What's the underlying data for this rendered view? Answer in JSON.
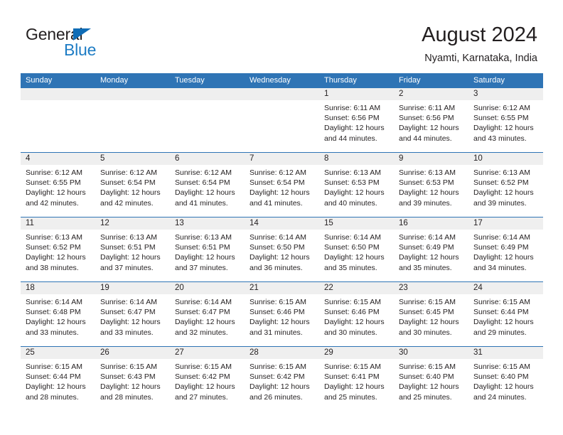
{
  "brand": {
    "name_part1": "General",
    "name_part2": "Blue",
    "triangle_icon": "triangle-icon",
    "colors": {
      "dark": "#231f20",
      "blue": "#1d7cc4",
      "triangle": "#0f6cb6"
    }
  },
  "header": {
    "month_title": "August 2024",
    "location": "Nyamti, Karnataka, India"
  },
  "calendar": {
    "accent_color": "#2f74b5",
    "daynum_strip_color": "#efefef",
    "weekdays": [
      "Sunday",
      "Monday",
      "Tuesday",
      "Wednesday",
      "Thursday",
      "Friday",
      "Saturday"
    ],
    "weeks": [
      [
        {
          "day": "",
          "empty": true
        },
        {
          "day": "",
          "empty": true
        },
        {
          "day": "",
          "empty": true
        },
        {
          "day": "",
          "empty": true
        },
        {
          "day": "1",
          "sunrise": "Sunrise: 6:11 AM",
          "sunset": "Sunset: 6:56 PM",
          "daylight1": "Daylight: 12 hours",
          "daylight2": "and 44 minutes."
        },
        {
          "day": "2",
          "sunrise": "Sunrise: 6:11 AM",
          "sunset": "Sunset: 6:56 PM",
          "daylight1": "Daylight: 12 hours",
          "daylight2": "and 44 minutes."
        },
        {
          "day": "3",
          "sunrise": "Sunrise: 6:12 AM",
          "sunset": "Sunset: 6:55 PM",
          "daylight1": "Daylight: 12 hours",
          "daylight2": "and 43 minutes."
        }
      ],
      [
        {
          "day": "4",
          "sunrise": "Sunrise: 6:12 AM",
          "sunset": "Sunset: 6:55 PM",
          "daylight1": "Daylight: 12 hours",
          "daylight2": "and 42 minutes."
        },
        {
          "day": "5",
          "sunrise": "Sunrise: 6:12 AM",
          "sunset": "Sunset: 6:54 PM",
          "daylight1": "Daylight: 12 hours",
          "daylight2": "and 42 minutes."
        },
        {
          "day": "6",
          "sunrise": "Sunrise: 6:12 AM",
          "sunset": "Sunset: 6:54 PM",
          "daylight1": "Daylight: 12 hours",
          "daylight2": "and 41 minutes."
        },
        {
          "day": "7",
          "sunrise": "Sunrise: 6:12 AM",
          "sunset": "Sunset: 6:54 PM",
          "daylight1": "Daylight: 12 hours",
          "daylight2": "and 41 minutes."
        },
        {
          "day": "8",
          "sunrise": "Sunrise: 6:13 AM",
          "sunset": "Sunset: 6:53 PM",
          "daylight1": "Daylight: 12 hours",
          "daylight2": "and 40 minutes."
        },
        {
          "day": "9",
          "sunrise": "Sunrise: 6:13 AM",
          "sunset": "Sunset: 6:53 PM",
          "daylight1": "Daylight: 12 hours",
          "daylight2": "and 39 minutes."
        },
        {
          "day": "10",
          "sunrise": "Sunrise: 6:13 AM",
          "sunset": "Sunset: 6:52 PM",
          "daylight1": "Daylight: 12 hours",
          "daylight2": "and 39 minutes."
        }
      ],
      [
        {
          "day": "11",
          "sunrise": "Sunrise: 6:13 AM",
          "sunset": "Sunset: 6:52 PM",
          "daylight1": "Daylight: 12 hours",
          "daylight2": "and 38 minutes."
        },
        {
          "day": "12",
          "sunrise": "Sunrise: 6:13 AM",
          "sunset": "Sunset: 6:51 PM",
          "daylight1": "Daylight: 12 hours",
          "daylight2": "and 37 minutes."
        },
        {
          "day": "13",
          "sunrise": "Sunrise: 6:13 AM",
          "sunset": "Sunset: 6:51 PM",
          "daylight1": "Daylight: 12 hours",
          "daylight2": "and 37 minutes."
        },
        {
          "day": "14",
          "sunrise": "Sunrise: 6:14 AM",
          "sunset": "Sunset: 6:50 PM",
          "daylight1": "Daylight: 12 hours",
          "daylight2": "and 36 minutes."
        },
        {
          "day": "15",
          "sunrise": "Sunrise: 6:14 AM",
          "sunset": "Sunset: 6:50 PM",
          "daylight1": "Daylight: 12 hours",
          "daylight2": "and 35 minutes."
        },
        {
          "day": "16",
          "sunrise": "Sunrise: 6:14 AM",
          "sunset": "Sunset: 6:49 PM",
          "daylight1": "Daylight: 12 hours",
          "daylight2": "and 35 minutes."
        },
        {
          "day": "17",
          "sunrise": "Sunrise: 6:14 AM",
          "sunset": "Sunset: 6:49 PM",
          "daylight1": "Daylight: 12 hours",
          "daylight2": "and 34 minutes."
        }
      ],
      [
        {
          "day": "18",
          "sunrise": "Sunrise: 6:14 AM",
          "sunset": "Sunset: 6:48 PM",
          "daylight1": "Daylight: 12 hours",
          "daylight2": "and 33 minutes."
        },
        {
          "day": "19",
          "sunrise": "Sunrise: 6:14 AM",
          "sunset": "Sunset: 6:47 PM",
          "daylight1": "Daylight: 12 hours",
          "daylight2": "and 33 minutes."
        },
        {
          "day": "20",
          "sunrise": "Sunrise: 6:14 AM",
          "sunset": "Sunset: 6:47 PM",
          "daylight1": "Daylight: 12 hours",
          "daylight2": "and 32 minutes."
        },
        {
          "day": "21",
          "sunrise": "Sunrise: 6:15 AM",
          "sunset": "Sunset: 6:46 PM",
          "daylight1": "Daylight: 12 hours",
          "daylight2": "and 31 minutes."
        },
        {
          "day": "22",
          "sunrise": "Sunrise: 6:15 AM",
          "sunset": "Sunset: 6:46 PM",
          "daylight1": "Daylight: 12 hours",
          "daylight2": "and 30 minutes."
        },
        {
          "day": "23",
          "sunrise": "Sunrise: 6:15 AM",
          "sunset": "Sunset: 6:45 PM",
          "daylight1": "Daylight: 12 hours",
          "daylight2": "and 30 minutes."
        },
        {
          "day": "24",
          "sunrise": "Sunrise: 6:15 AM",
          "sunset": "Sunset: 6:44 PM",
          "daylight1": "Daylight: 12 hours",
          "daylight2": "and 29 minutes."
        }
      ],
      [
        {
          "day": "25",
          "sunrise": "Sunrise: 6:15 AM",
          "sunset": "Sunset: 6:44 PM",
          "daylight1": "Daylight: 12 hours",
          "daylight2": "and 28 minutes."
        },
        {
          "day": "26",
          "sunrise": "Sunrise: 6:15 AM",
          "sunset": "Sunset: 6:43 PM",
          "daylight1": "Daylight: 12 hours",
          "daylight2": "and 28 minutes."
        },
        {
          "day": "27",
          "sunrise": "Sunrise: 6:15 AM",
          "sunset": "Sunset: 6:42 PM",
          "daylight1": "Daylight: 12 hours",
          "daylight2": "and 27 minutes."
        },
        {
          "day": "28",
          "sunrise": "Sunrise: 6:15 AM",
          "sunset": "Sunset: 6:42 PM",
          "daylight1": "Daylight: 12 hours",
          "daylight2": "and 26 minutes."
        },
        {
          "day": "29",
          "sunrise": "Sunrise: 6:15 AM",
          "sunset": "Sunset: 6:41 PM",
          "daylight1": "Daylight: 12 hours",
          "daylight2": "and 25 minutes."
        },
        {
          "day": "30",
          "sunrise": "Sunrise: 6:15 AM",
          "sunset": "Sunset: 6:40 PM",
          "daylight1": "Daylight: 12 hours",
          "daylight2": "and 25 minutes."
        },
        {
          "day": "31",
          "sunrise": "Sunrise: 6:15 AM",
          "sunset": "Sunset: 6:40 PM",
          "daylight1": "Daylight: 12 hours",
          "daylight2": "and 24 minutes."
        }
      ]
    ]
  }
}
